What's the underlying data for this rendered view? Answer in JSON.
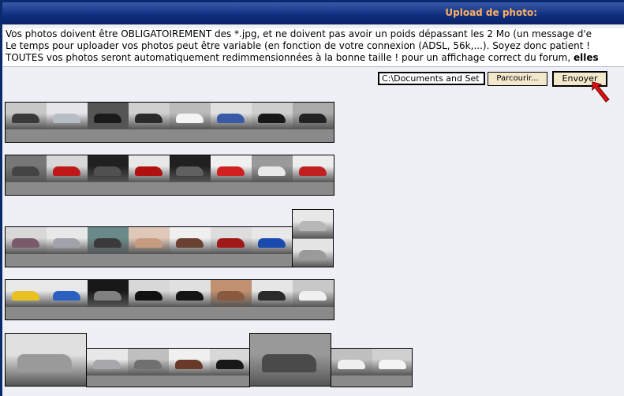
{
  "window": {
    "title": "Upload de photo:"
  },
  "info": {
    "line1": "Vos photos doivent être OBLIGATOIREMENT des *.jpg, et ne doivent pas avoir un poids dépassant les 2 Mo (un message d'e",
    "line2": "Le temps pour uploader vos photos peut être variable (en fonction de votre connexion (ADSL, 56k,...). Soyez donc patient !",
    "line3_start": "TOUTES vos photos seront automatiquement redimmensionnées à la bonne taille ! pour un affichage correct du forum, ",
    "line3_bold": "elles"
  },
  "upload": {
    "file_path": "C:\\Documents and Set",
    "browse_label": "Parcourir...",
    "send_label": "Envoyer"
  },
  "colors": {
    "title_text": "#ffb060",
    "title_bar": "#0e2e80",
    "button_bg": "#f2e8cc"
  },
  "thumbnails": {
    "row1": [
      "dark-sedan",
      "silver-suv",
      "black-coupe",
      "dark-car-road",
      "white-car",
      "blue-car-studio",
      "black-car-side",
      "black-car-front"
    ],
    "row2": [
      "dashboard",
      "red-car-front",
      "steering-detail",
      "red-car-side",
      "interior-console",
      "red-taillight",
      "white-van",
      "red-hatchback"
    ],
    "row3": [
      "purple-car",
      "silver-car",
      "dashboard-display",
      "leather-seat",
      "brown-car",
      "red-van",
      "blue-car",
      "silver-car-front",
      "silver-car-rear"
    ],
    "row4": [
      "yellow-car",
      "blue-coupe",
      "alloy-wheel",
      "black-sedan",
      "black-hatchback",
      "brown-interior",
      "dark-suv",
      "white-hatchback"
    ],
    "row5": [
      "speaker-detail",
      "silver-front",
      "headlight",
      "brown-suv",
      "black-car",
      "gear-stick",
      "white-coupe",
      "white-car-side"
    ]
  }
}
